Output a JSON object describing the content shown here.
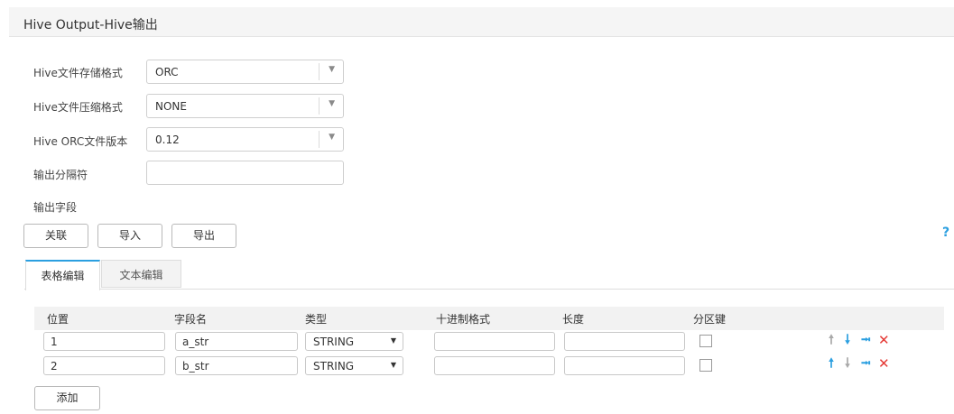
{
  "header": {
    "title": "Hive Output-Hive输出"
  },
  "form": {
    "storage_format": {
      "label": "Hive文件存储格式",
      "value": "ORC"
    },
    "compression_format": {
      "label": "Hive文件压缩格式",
      "value": "NONE"
    },
    "orc_version": {
      "label": "Hive ORC文件版本",
      "value": "0.12"
    },
    "delimiter": {
      "label": "输出分隔符",
      "value": ""
    },
    "output_fields_label": "输出字段"
  },
  "buttons": {
    "associate": "关联",
    "import": "导入",
    "export": "导出",
    "help": "?"
  },
  "tabs": [
    {
      "label": "表格编辑",
      "active": true
    },
    {
      "label": "文本编辑",
      "active": false
    }
  ],
  "table": {
    "columns": [
      "位置",
      "字段名",
      "类型",
      "十进制格式",
      "长度",
      "分区键"
    ],
    "rows": [
      {
        "position": "1",
        "field_name": "a_str",
        "type": "STRING",
        "decimal_format": "",
        "length": "",
        "partition_key": false,
        "up_enabled": false,
        "down_enabled": true
      },
      {
        "position": "2",
        "field_name": "b_str",
        "type": "STRING",
        "decimal_format": "",
        "length": "",
        "partition_key": false,
        "up_enabled": true,
        "down_enabled": false
      }
    ],
    "add_label": "添加"
  },
  "icons": {
    "up": "arrow-up-icon",
    "down": "arrow-down-icon",
    "insert": "insert-row-icon",
    "delete": "delete-icon"
  },
  "colors": {
    "accent": "#2b9fe0",
    "danger": "#e53935",
    "disabled": "#a9a9a9"
  }
}
